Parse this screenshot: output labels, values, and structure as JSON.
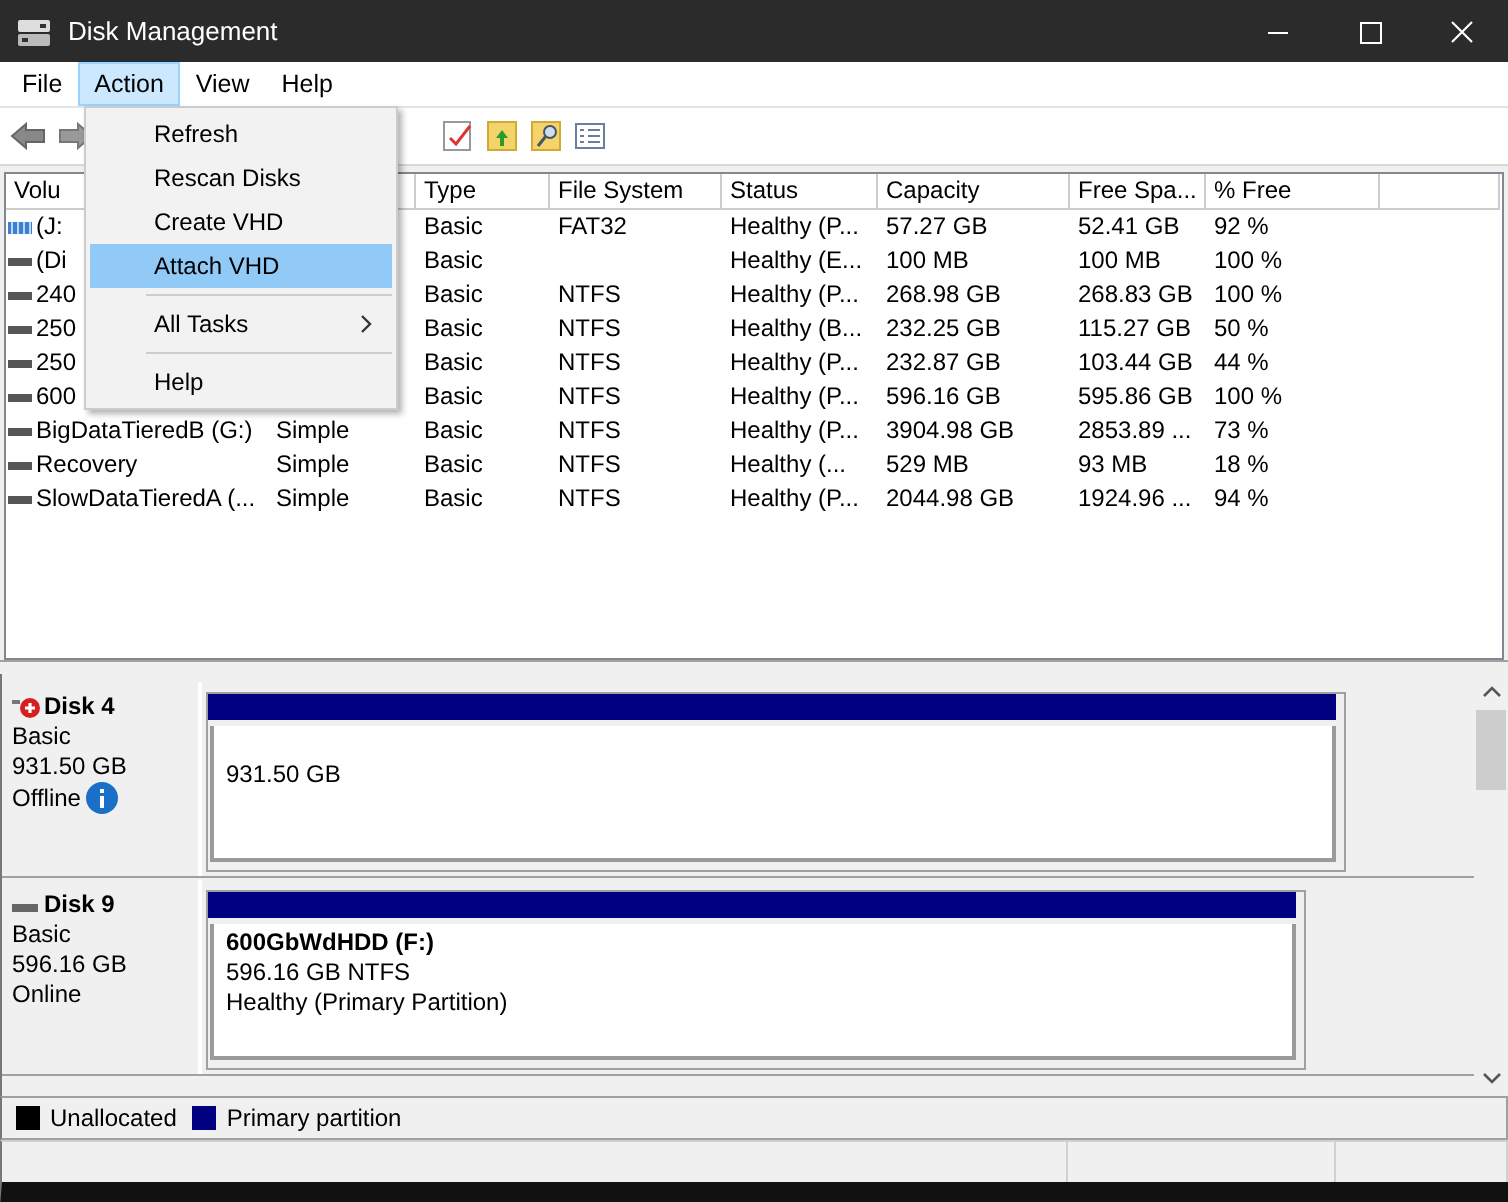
{
  "window": {
    "title": "Disk Management"
  },
  "menubar": [
    {
      "label": "File",
      "selected": false
    },
    {
      "label": "Action",
      "selected": true
    },
    {
      "label": "View",
      "selected": false
    },
    {
      "label": "Help",
      "selected": false
    }
  ],
  "menu": [
    {
      "kind": "item",
      "label": "Refresh",
      "selected": false
    },
    {
      "kind": "item",
      "label": "Rescan Disks",
      "selected": false
    },
    {
      "kind": "item",
      "label": "Create VHD",
      "selected": false
    },
    {
      "kind": "item",
      "label": "Attach VHD",
      "selected": true
    },
    {
      "kind": "separator"
    },
    {
      "kind": "submenu",
      "label": "All Tasks",
      "selected": false
    },
    {
      "kind": "separator"
    },
    {
      "kind": "item",
      "label": "Help",
      "selected": false
    }
  ],
  "table": {
    "columns": [
      {
        "label": "Volu"
      },
      {},
      {
        "label": "Type"
      },
      {
        "label": "File System"
      },
      {
        "label": "Status"
      },
      {
        "label": "Capacity"
      },
      {
        "label": "Free Spa..."
      },
      {
        "label": "% Free"
      },
      {}
    ],
    "rows": [
      {
        "kind": "removable",
        "cells": [
          "(J:",
          null,
          "Basic",
          "FAT32",
          "Healthy (P...",
          "57.27 GB",
          "52.41 GB",
          "92 %"
        ]
      },
      {
        "kind": "drive",
        "cells": [
          "(Di",
          null,
          "Basic",
          null,
          "Healthy (E...",
          "100 MB",
          "100 MB",
          "100 %"
        ]
      },
      {
        "kind": "drive",
        "cells": [
          "240",
          null,
          "Basic",
          "NTFS",
          "Healthy (P...",
          "268.98 GB",
          "268.83 GB",
          "100 %"
        ]
      },
      {
        "kind": "drive",
        "cells": [
          "250",
          null,
          "Basic",
          "NTFS",
          "Healthy (B...",
          "232.25 GB",
          "115.27 GB",
          "50 %"
        ]
      },
      {
        "kind": "drive",
        "cells": [
          "250",
          null,
          "Basic",
          "NTFS",
          "Healthy (P...",
          "232.87 GB",
          "103.44 GB",
          "44 %"
        ]
      },
      {
        "kind": "drive",
        "cells": [
          "600",
          null,
          "Basic",
          "NTFS",
          "Healthy (P...",
          "596.16 GB",
          "595.86 GB",
          "100 %"
        ]
      },
      {
        "kind": "drive",
        "cells": [
          "BigDataTieredB (G:)",
          "Simple",
          "Basic",
          "NTFS",
          "Healthy (P...",
          "3904.98 GB",
          "2853.89 ...",
          "73 %"
        ]
      },
      {
        "kind": "drive",
        "cells": [
          "Recovery",
          "Simple",
          "Basic",
          "NTFS",
          "Healthy (...",
          "529 MB",
          "93 MB",
          "18 %"
        ]
      },
      {
        "kind": "drive",
        "cells": [
          "SlowDataTieredA (...",
          "Simple",
          "Basic",
          "NTFS",
          "Healthy (P...",
          "2044.98 GB",
          "1924.96 ...",
          "94 %"
        ]
      }
    ]
  },
  "disks": [
    {
      "kind": "offline",
      "name": "Disk 4",
      "type": "Basic",
      "size": "931.50 GB",
      "status": "Offline",
      "partition": {
        "lines": [
          "931.50 GB"
        ]
      }
    },
    {
      "kind": "online",
      "name": "Disk 9",
      "type": "Basic",
      "size": "596.16 GB",
      "status": "Online",
      "partition": {
        "title": "600GbWdHDD  (F:)",
        "lines": [
          "596.16 GB NTFS",
          "Healthy (Primary Partition)"
        ]
      }
    }
  ],
  "legend": [
    {
      "label": "Unallocated",
      "color": "#000000"
    },
    {
      "label": "Primary partition",
      "color": "#000080"
    }
  ]
}
